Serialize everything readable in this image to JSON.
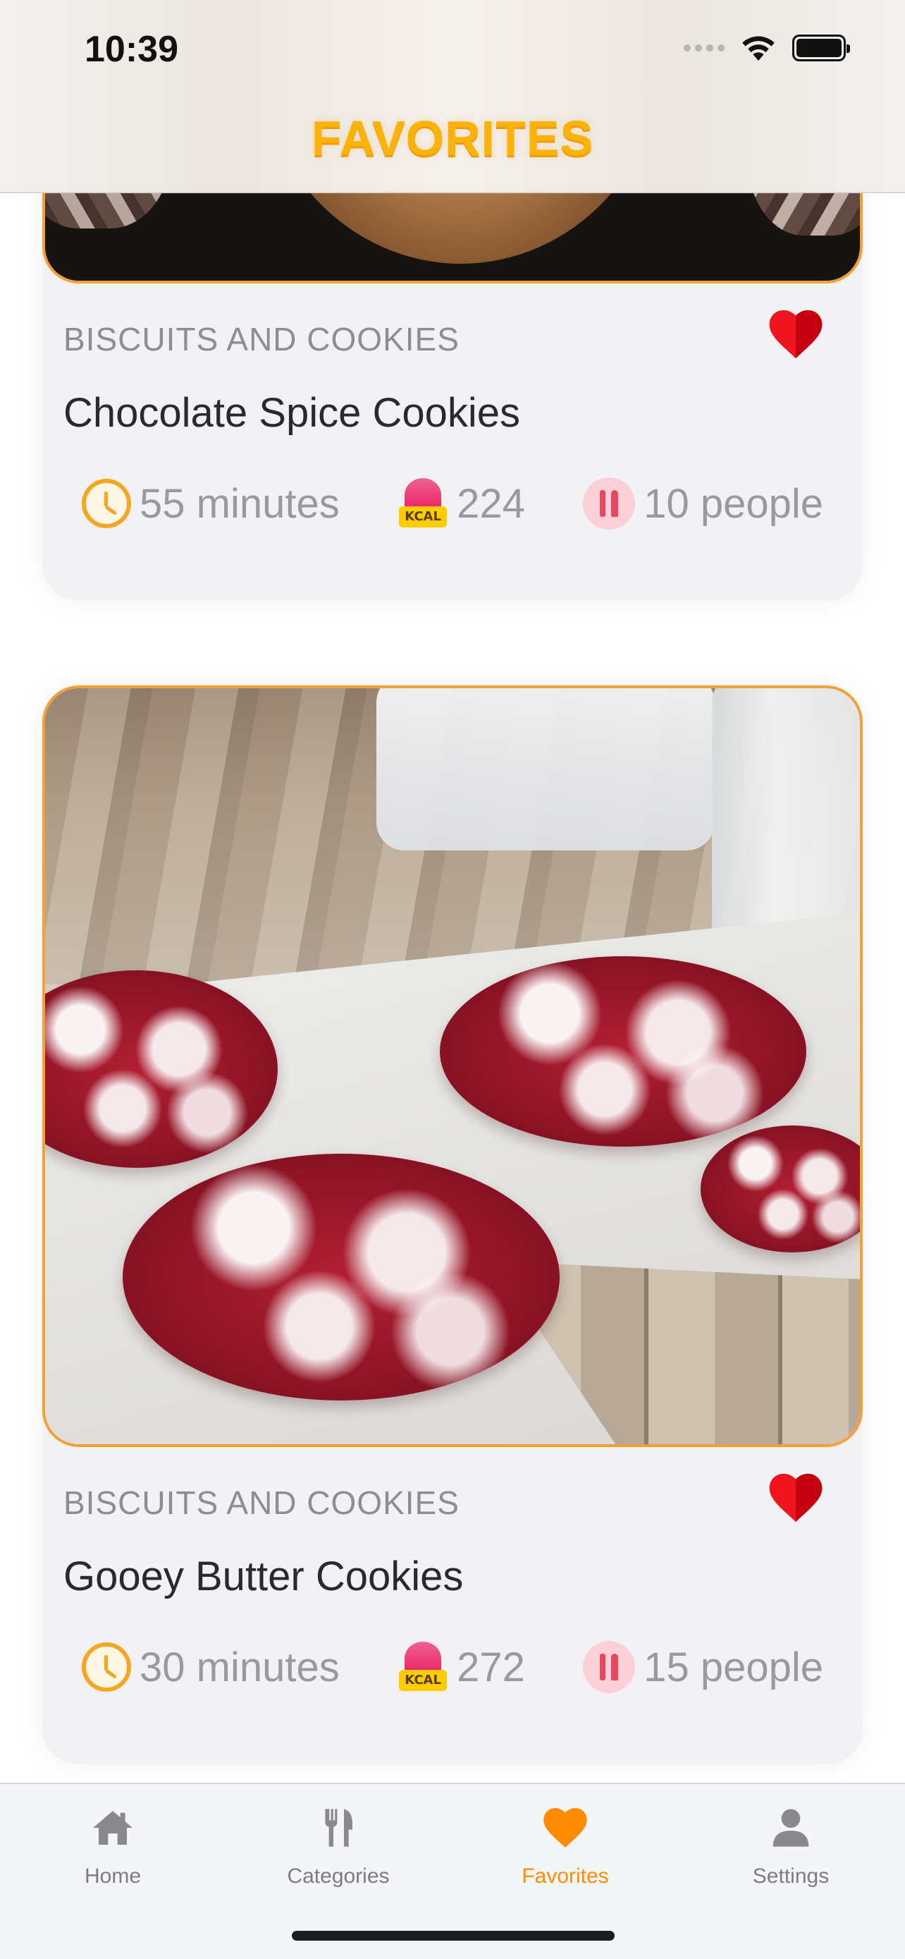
{
  "status_bar": {
    "time": "10:39"
  },
  "header": {
    "title": "FAVORITES"
  },
  "recipes": [
    {
      "category": "BISCUITS AND COOKIES",
      "title": "Chocolate Spice Cookies",
      "duration": "55 minutes",
      "calories": "224",
      "servings": "10 people",
      "favorite": true
    },
    {
      "category": "BISCUITS AND COOKIES",
      "title": "Gooey Butter Cookies",
      "duration": "30 minutes",
      "calories": "272",
      "servings": "15 people",
      "favorite": true
    }
  ],
  "icons": {
    "duration": "clock-icon",
    "calories": "kcal-icon",
    "servings": "utensils-icon",
    "favorite": "heart-icon"
  },
  "kcal_badge": "KCAL",
  "tabs": [
    {
      "label": "Home",
      "icon": "house-icon",
      "active": false
    },
    {
      "label": "Categories",
      "icon": "utensils-icon",
      "active": false
    },
    {
      "label": "Favorites",
      "icon": "heart-icon",
      "active": true
    },
    {
      "label": "Settings",
      "icon": "user-icon",
      "active": false
    }
  ],
  "colors": {
    "accent": "#ff8c00",
    "title": "#fbb30c",
    "heart": "#f0141e",
    "card_border": "#f5a037",
    "card_bg": "#f2f1f4"
  }
}
